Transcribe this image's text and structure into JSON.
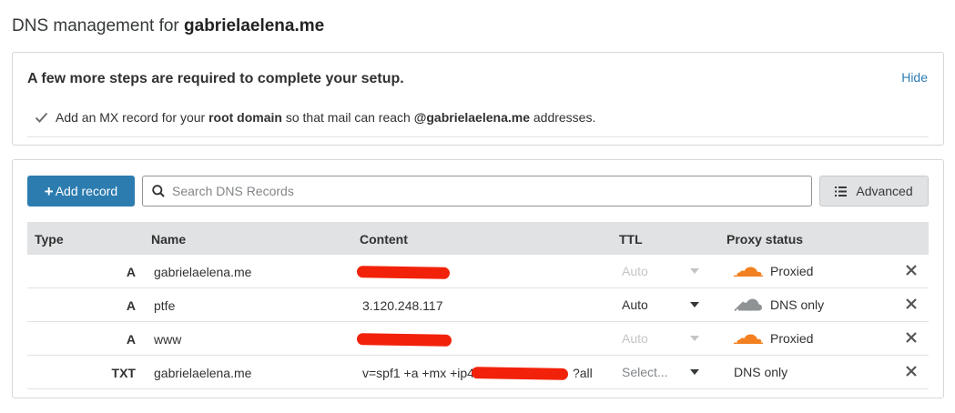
{
  "page": {
    "title_prefix": "DNS management for",
    "domain": "gabrielaelena.me"
  },
  "setup": {
    "heading": "A few more steps are required to complete your setup.",
    "hide_label": "Hide",
    "item": {
      "text_1": "Add an MX record for your ",
      "bold_1": "root domain",
      "text_2": " so that mail can reach ",
      "bold_2": "@gabrielaelena.me",
      "text_3": " addresses."
    }
  },
  "toolbar": {
    "add_label": "Add record",
    "add_plus": "+",
    "search_placeholder": "Search DNS Records",
    "advanced_label": "Advanced"
  },
  "table": {
    "headers": {
      "type": "Type",
      "name": "Name",
      "content": "Content",
      "ttl": "TTL",
      "proxy": "Proxy status"
    },
    "rows": [
      {
        "type": "A",
        "name": "gabrielaelena.me",
        "content": "",
        "ttl": "Auto",
        "ttl_state": "disabled",
        "proxy": "Proxied",
        "proxy_icon": "orange-cloud-icon"
      },
      {
        "type": "A",
        "name": "ptfe",
        "content": "3.120.248.117",
        "ttl": "Auto",
        "ttl_state": "enabled",
        "proxy": "DNS only",
        "proxy_icon": "grey-cloud-icon"
      },
      {
        "type": "A",
        "name": "www",
        "content": "",
        "ttl": "Auto",
        "ttl_state": "disabled",
        "proxy": "Proxied",
        "proxy_icon": "orange-cloud-icon"
      },
      {
        "type": "TXT",
        "name": "gabrielaelena.me",
        "content": "v=spf1 +a +mx +ip4",
        "content_tail": "?all",
        "ttl": "Select...",
        "ttl_state": "placeholder",
        "proxy": "DNS only",
        "proxy_icon": ""
      }
    ]
  },
  "colors": {
    "accent": "#2c7cb0",
    "proxied_orange": "#f38020",
    "redaction": "#f2220a",
    "header_bg": "#e1e2e3"
  }
}
